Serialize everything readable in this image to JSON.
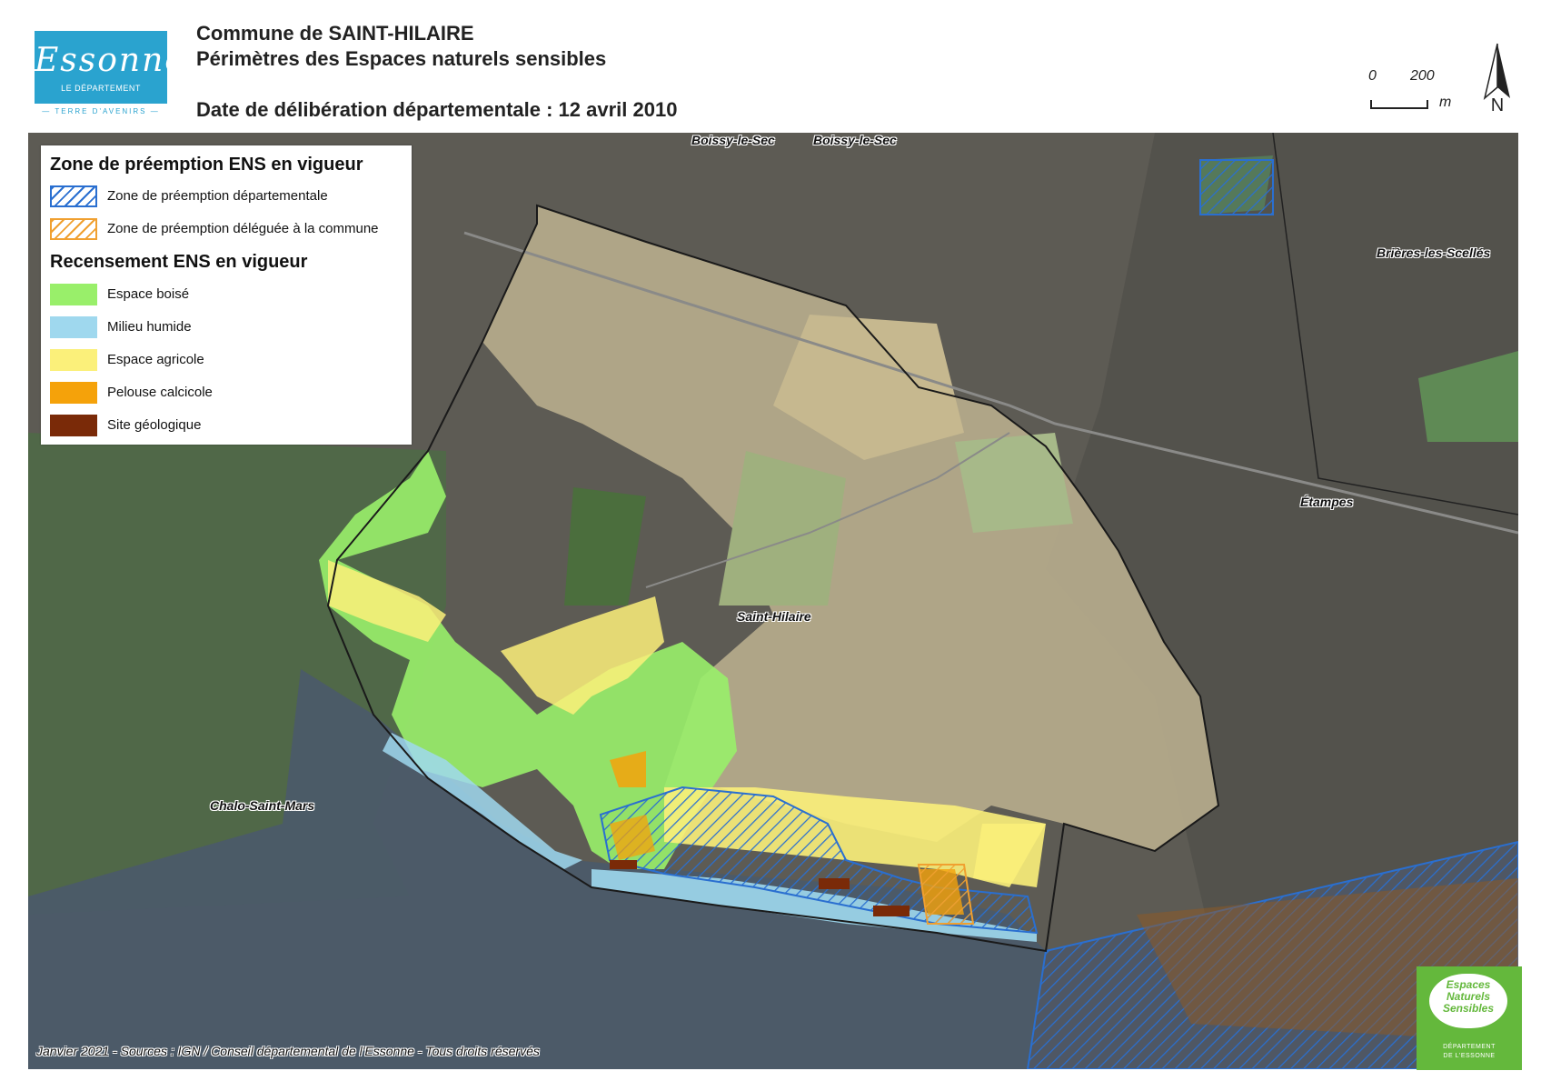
{
  "header": {
    "logo": {
      "script": "Essonne",
      "subtitle": "LE DÉPARTEMENT",
      "tagline": "— TERRE D'AVENIRS —"
    },
    "title_line1": "Commune de SAINT-HILAIRE",
    "title_line2": "Périmètres des Espaces naturels sensibles",
    "title_line3": "Date de délibération départementale : 12 avril 2010",
    "scale": {
      "label_zero": "0",
      "label_200": "200",
      "unit": "m"
    },
    "north_label": "N"
  },
  "legend": {
    "section1_title": "Zone de préemption ENS en vigueur",
    "section1_items": [
      {
        "label": "Zone de préemption départementale",
        "color": "#2a6fd0"
      },
      {
        "label": "Zone de préemption déléguée à la commune",
        "color": "#f0a030"
      }
    ],
    "section2_title": "Recensement ENS en vigueur",
    "section2_items": [
      {
        "label": "Espace boisé",
        "color": "#99ef6a"
      },
      {
        "label": "Milieu humide",
        "color": "#9fd8ee"
      },
      {
        "label": "Espace agricole",
        "color": "#fbf07a"
      },
      {
        "label": "Pelouse calcicole",
        "color": "#f5a20a"
      },
      {
        "label": "Site géologique",
        "color": "#7a2a08"
      }
    ]
  },
  "places": {
    "boissy1": "Boissy-le-Sec",
    "boissy2": "Boissy-le-Sec",
    "brieres": "Brières-les-Scellés",
    "etampes": "Étampes",
    "saint_hilaire": "Saint-Hilaire",
    "chalo": "Chalo-Saint-Mars"
  },
  "credits": "Janvier 2021 - Sources : IGN / Conseil départemental de l'Essonne - Tous droits réservés",
  "ens_logo": {
    "line1": "Espaces",
    "line2": "Naturels",
    "line3": "Sensibles",
    "sub1": "DÉPARTEMENT",
    "sub2": "DE L'ESSONNE"
  }
}
